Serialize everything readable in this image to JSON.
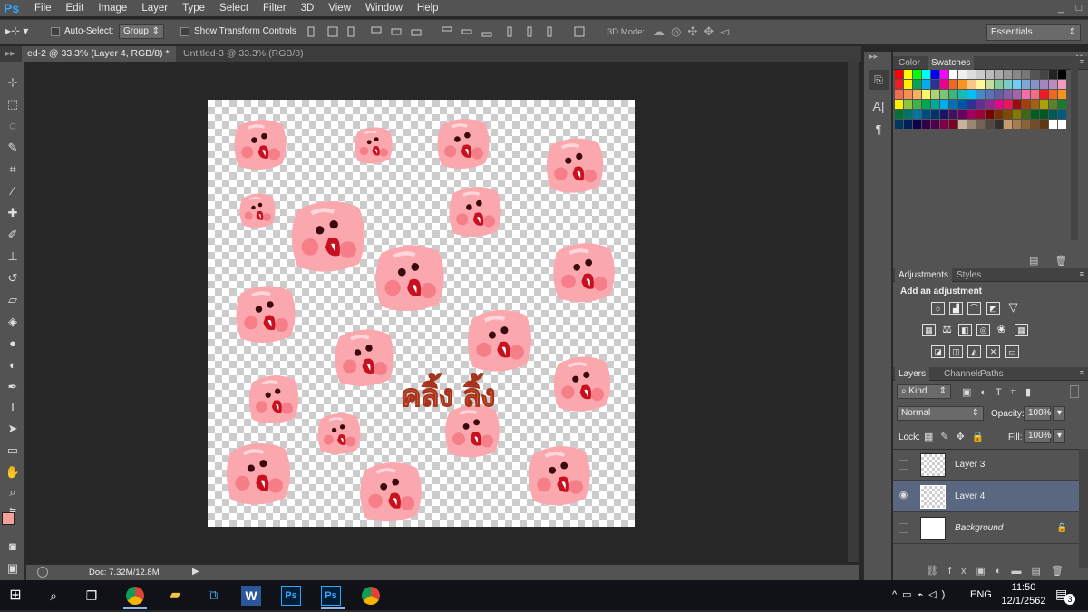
{
  "app": {
    "logo": "Ps"
  },
  "menu": [
    "File",
    "Edit",
    "Image",
    "Layer",
    "Type",
    "Select",
    "Filter",
    "3D",
    "View",
    "Window",
    "Help"
  ],
  "window_controls": [
    "_",
    "□"
  ],
  "options": {
    "auto_select_label": "Auto-Select:",
    "auto_select_value": "Group",
    "show_transform_label": "Show Transform Controls",
    "mode_3d_label": "3D Mode:",
    "workspace": "Essentials"
  },
  "tabs": [
    {
      "label": "ed-2 @ 33.3% (Layer 4, RGB/8) *",
      "close": "×",
      "active": true
    },
    {
      "label": "Untitled-3 @ 33.3% (RGB/8)",
      "close": "×",
      "active": false
    }
  ],
  "status": {
    "doc": "Doc: 7.32M/12.8M"
  },
  "panels": {
    "color_tab": "Color",
    "swatches_tab": "Swatches",
    "adjustments_tab": "Adjustments",
    "styles_tab": "Styles",
    "add_adjustment": "Add an adjustment",
    "layers_tab": "Layers",
    "channels_tab": "Channels",
    "paths_tab": "Paths",
    "kind_filter": "Kind",
    "blend_mode": "Normal",
    "opacity_label": "Opacity:",
    "opacity_value": "100%",
    "lock_label": "Lock:",
    "fill_label": "Fill:",
    "fill_value": "100%"
  },
  "layers": [
    {
      "name": "Layer 3",
      "visible": false,
      "selected": false
    },
    {
      "name": "Layer 4",
      "visible": true,
      "selected": true
    },
    {
      "name": "Background",
      "visible": false,
      "selected": false
    }
  ],
  "canvas_text": "คลิ้ง ลิ้ง",
  "colors": {
    "foreground": "#f4a09a",
    "background": "#ffffff",
    "pig_pink": "#fba7ae",
    "mouth_red": "#c8101e",
    "accent_blue": "#31a8ff"
  },
  "swatch_colors": [
    "#ff0000",
    "#ffff00",
    "#00ff00",
    "#00ffff",
    "#0000ff",
    "#ff00ff",
    "#ffffff",
    "#eeeeee",
    "#dddddd",
    "#cccccc",
    "#bbbbbb",
    "#aaaaaa",
    "#999999",
    "#888888",
    "#777777",
    "#555555",
    "#444444",
    "#222222",
    "#000000",
    "#ee1c24",
    "#fff200",
    "#00a651",
    "#00aeef",
    "#2e3192",
    "#ec008c",
    "#f26522",
    "#f7941d",
    "#fdc689",
    "#fff799",
    "#c4df9b",
    "#82ca9c",
    "#7accc8",
    "#6dcff6",
    "#7da7d9",
    "#8393ca",
    "#a187be",
    "#bd8cbf",
    "#f49ac2",
    "#f26c4f",
    "#f68e56",
    "#fbaf5d",
    "#fff568",
    "#acd372",
    "#7cc576",
    "#3bb878",
    "#1abbb4",
    "#00bff3",
    "#438ccb",
    "#5574b9",
    "#605ca8",
    "#855fa8",
    "#a763a8",
    "#f06ea9",
    "#f26d7d",
    "#ed1c24",
    "#f26522",
    "#f7941d",
    "#fff200",
    "#8dc73f",
    "#39b54a",
    "#00a651",
    "#00a99d",
    "#00aeef",
    "#0072bc",
    "#0054a6",
    "#2e3192",
    "#662d91",
    "#92278f",
    "#ec008c",
    "#ed145b",
    "#9e0b0f",
    "#a0410d",
    "#a3620a",
    "#aba000",
    "#598527",
    "#1a7b30",
    "#007236",
    "#00746b",
    "#0076a3",
    "#004a80",
    "#003471",
    "#1b1464",
    "#440e62",
    "#630460",
    "#9e005d",
    "#9e0039",
    "#790000",
    "#7b2e00",
    "#7d4900",
    "#827b00",
    "#406618",
    "#005e20",
    "#005826",
    "#005952",
    "#005b7f",
    "#003663",
    "#002157",
    "#0d004c",
    "#32004b",
    "#4b0049",
    "#7b0046",
    "#7a0026",
    "#c7b299",
    "#998675",
    "#736357",
    "#534741",
    "#37302a",
    "#c69c6d",
    "#a67c52",
    "#8c6239",
    "#754c24",
    "#603913",
    "#ffffff",
    "#ffffff"
  ],
  "taskbar": {
    "lang": "ENG",
    "time": "11:50",
    "date": "12/1/2562",
    "notifications": "3"
  }
}
